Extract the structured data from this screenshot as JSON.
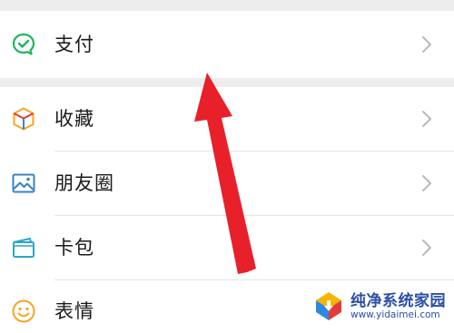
{
  "menu": {
    "items": [
      {
        "id": "pay",
        "label": "支付",
        "icon": "wechat-pay-icon",
        "color": "#22b35e"
      },
      {
        "id": "favorites",
        "label": "收藏",
        "icon": "cube-icon",
        "color": "#f5a623"
      },
      {
        "id": "moments",
        "label": "朋友圈",
        "icon": "picture-icon",
        "color": "#3b82c4"
      },
      {
        "id": "cards",
        "label": "卡包",
        "icon": "wallet-icon",
        "color": "#2aa6c9"
      },
      {
        "id": "stickers",
        "label": "表情",
        "icon": "smile-icon",
        "color": "#f5a623"
      }
    ]
  },
  "annotation": {
    "arrow_color": "#e8202a"
  },
  "watermark": {
    "title": "纯净系统家园",
    "url": "www.yidaimei.com"
  }
}
